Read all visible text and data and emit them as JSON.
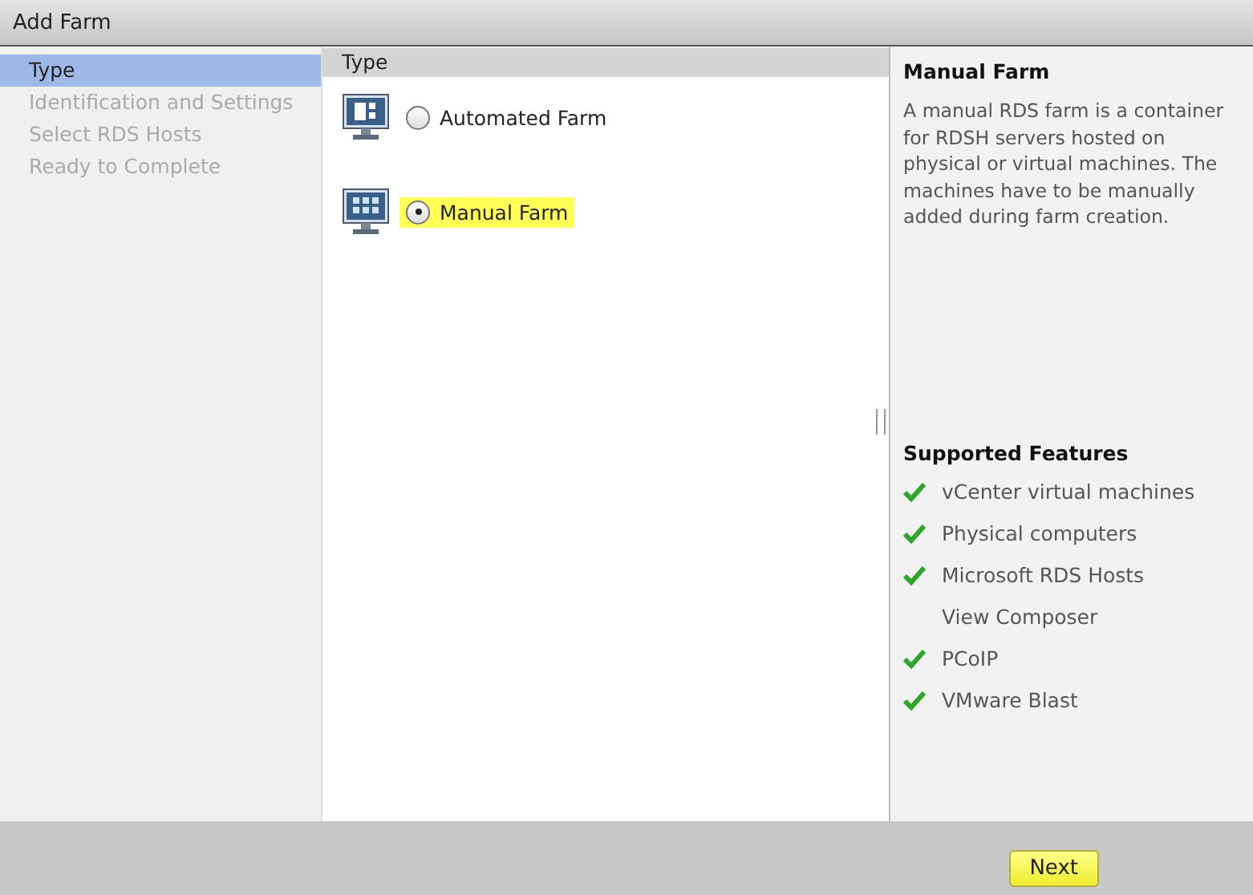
{
  "window": {
    "title": "Add Farm"
  },
  "steps": [
    {
      "label": "Type",
      "selected": true,
      "disabled": false
    },
    {
      "label": "Identification and Settings",
      "selected": false,
      "disabled": true
    },
    {
      "label": "Select RDS Hosts",
      "selected": false,
      "disabled": true
    },
    {
      "label": "Ready to Complete",
      "selected": false,
      "disabled": true
    }
  ],
  "type_panel": {
    "header": "Type",
    "options": [
      {
        "label": "Automated Farm",
        "kind": "automated",
        "selected": false
      },
      {
        "label": "Manual Farm",
        "kind": "manual",
        "selected": true
      }
    ]
  },
  "info": {
    "title": "Manual Farm",
    "description": "A manual RDS farm is a container for RDSH servers hosted on physical or virtual machines. The machines have to be manually added during farm creation.",
    "features_title": "Supported Features",
    "features": [
      {
        "label": "vCenter virtual machines",
        "checked": true
      },
      {
        "label": "Physical computers",
        "checked": true
      },
      {
        "label": "Microsoft RDS Hosts",
        "checked": true
      },
      {
        "label": "View Composer",
        "checked": false
      },
      {
        "label": "PCoIP",
        "checked": true
      },
      {
        "label": "VMware Blast",
        "checked": true
      }
    ]
  },
  "buttons": [
    {
      "label": "Next"
    }
  ]
}
